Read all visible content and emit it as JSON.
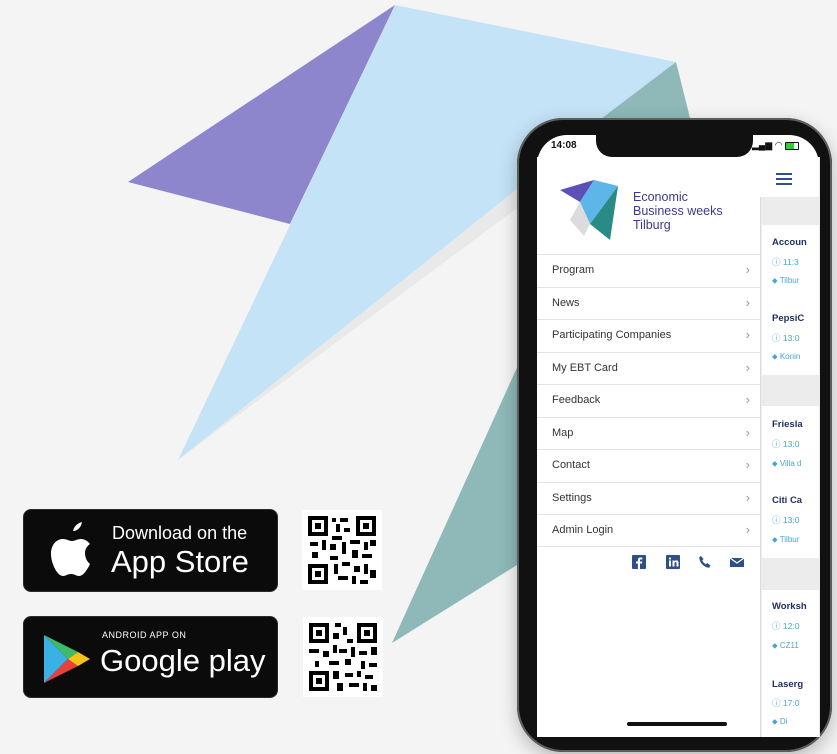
{
  "store_buttons": {
    "app_store": {
      "top_line": "Download on the",
      "main": "App Store"
    },
    "google_play": {
      "top_line": "ANDROID APP ON",
      "main": "Google play"
    }
  },
  "phone": {
    "status_time": "14:08",
    "brand": {
      "line1": "Economic",
      "line2": "Business weeks",
      "line3": "Tilburg"
    },
    "menu_items": [
      {
        "label": "Program"
      },
      {
        "label": "News"
      },
      {
        "label": "Participating Companies"
      },
      {
        "label": "My EBT Card"
      },
      {
        "label": "Feedback"
      },
      {
        "label": "Map"
      },
      {
        "label": "Contact"
      },
      {
        "label": "Settings"
      },
      {
        "label": "Admin Login"
      }
    ],
    "social_icons": [
      "facebook-icon",
      "linkedin-icon",
      "phone-icon",
      "mail-icon"
    ],
    "events": [
      {
        "title": "Accoun",
        "time": "11:3",
        "location": "Tilbur"
      },
      {
        "title": "PepsiC",
        "time": "13:0",
        "location": "Konin"
      },
      {
        "title": "Friesla",
        "time": "13:0",
        "location": "Villa d"
      },
      {
        "title": "Citi Ca",
        "time": "13:0",
        "location": "Tilbur"
      },
      {
        "title": "Worksh",
        "time": "12:0",
        "location": "CZ11"
      },
      {
        "title": "Laserg",
        "time": "17:0",
        "location": "Di"
      }
    ]
  },
  "colors": {
    "brand_purple": "#3e3a8e",
    "accent_blue": "#4aa3d0",
    "shape_purple": "#8e86cc",
    "shape_lightblue": "#c4e3f6",
    "shape_teal": "#8fb9b9"
  }
}
